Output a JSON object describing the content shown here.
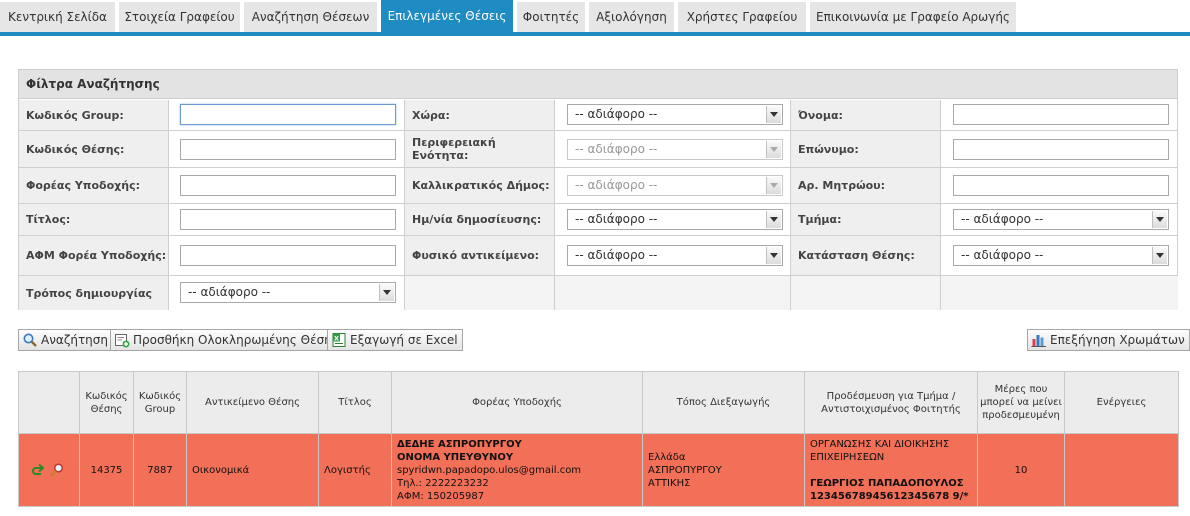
{
  "tabs": [
    {
      "label": "Κεντρική Σελίδα",
      "active": false
    },
    {
      "label": "Στοιχεία Γραφείου",
      "active": false
    },
    {
      "label": "Αναζήτηση Θέσεων",
      "active": false
    },
    {
      "label": "Επιλεγμένες Θέσεις",
      "active": true
    },
    {
      "label": "Φοιτητές",
      "active": false
    },
    {
      "label": "Αξιολόγηση",
      "active": false
    },
    {
      "label": "Χρήστες Γραφείου",
      "active": false
    },
    {
      "label": "Επικοινωνία με Γραφείο Αρωγής",
      "active": false
    }
  ],
  "filters": {
    "title": "Φίλτρα Αναζήτησης",
    "group_code": {
      "label": "Κωδικός Group:",
      "value": ""
    },
    "position_code": {
      "label": "Κωδικός Θέσης:",
      "value": ""
    },
    "host": {
      "label": "Φορέας Υποδοχής:",
      "value": ""
    },
    "title_field": {
      "label": "Τίτλος:",
      "value": ""
    },
    "host_afm": {
      "label": "ΑΦΜ Φορέα Υποδοχής:",
      "value": ""
    },
    "creation_method": {
      "label": "Τρόπος δημιουργίας",
      "value": "-- αδιάφορο --"
    },
    "country": {
      "label": "Χώρα:",
      "value": "-- αδιάφορο --"
    },
    "regional_unit": {
      "label": "Περιφερειακή Ενότητα:",
      "value": "-- αδιάφορο --"
    },
    "municipality": {
      "label": "Καλλικρατικός Δήμος:",
      "value": "-- αδιάφορο --"
    },
    "publish_date": {
      "label": "Ημ/νία δημοσίευσης:",
      "value": "-- αδιάφορο --"
    },
    "physical_object": {
      "label": "Φυσικό αντικείμενο:",
      "value": "-- αδιάφορο --"
    },
    "first_name": {
      "label": "Όνομα:",
      "value": ""
    },
    "last_name": {
      "label": "Επώνυμο:",
      "value": ""
    },
    "registry_no": {
      "label": "Αρ. Μητρώου:",
      "value": ""
    },
    "department": {
      "label": "Τμήμα:",
      "value": "-- αδιάφορο --"
    },
    "position_status": {
      "label": "Κατάσταση Θέσης:",
      "value": "-- αδιάφορο --"
    }
  },
  "buttons": {
    "search": "Αναζήτηση",
    "add_completed": "Προσθήκη Ολοκληρωμένης Θέσης",
    "export_excel": "Εξαγωγή σε Excel",
    "color_legend": "Επεξήγηση Χρωμάτων"
  },
  "table": {
    "headers": [
      "",
      "Κωδικός Θέσης",
      "Κωδικός Group",
      "Αντικείμενο Θέσης",
      "Τίτλος",
      "Φορέας Υποδοχής",
      "Τόπος Διεξαγωγής",
      "Προδέσμευση για Τμήμα / Αντιστοιχισμένος Φοιτητής",
      "Μέρες που μπορεί να μείνει προδεσμευμένη",
      "Ενέργειες"
    ],
    "rows": [
      {
        "position_code": "14375",
        "group_code": "7887",
        "subject": "Οικονομικά",
        "title": "Λογιστής",
        "host_name": "ΔΕΔΗΕ ΑΣΠΡΟΠΥΡΓΟΥ",
        "host_contact": "ΟΝΟΜΑ ΥΠΕΥΘΥΝΟΥ",
        "host_email": "spyridwn.papadopo.ulos@gmail.com",
        "host_phone": "Τηλ.: 2222223232",
        "host_afm": "ΑΦΜ: 150205987",
        "place_country": "Ελλάδα",
        "place_city": "ΑΣΠΡΟΠΥΡΓΟΥ",
        "place_region": "ΑΤΤΙΚΗΣ",
        "department": "ΟΡΓΑΝΩΣΗΣ ΚΑΙ ΔΙΟΙΚΗΣΗΣ ΕΠΙΧΕΙΡΗΣΕΩΝ",
        "student_name": "ΓΕΩΡΓΙΟΣ ΠΑΠΑΔΟΠΟΥΛΟΣ",
        "student_code": "12345678945612345678 9/*",
        "days": "10",
        "actions": ""
      }
    ]
  },
  "colors": {
    "tab_active": "#1e8bc3",
    "row_highlight": "#f26f58",
    "header_bg": "#e3e3e3"
  }
}
